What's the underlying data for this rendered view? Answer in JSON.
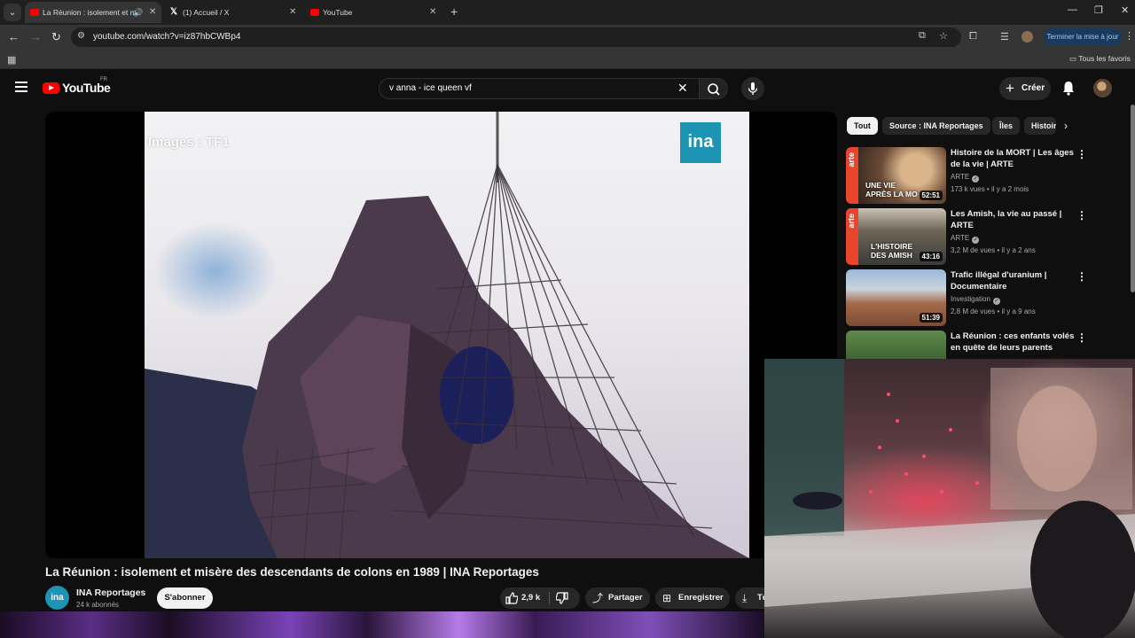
{
  "browser": {
    "tabs": [
      {
        "title": "La Réunion : isolement et m",
        "icon": "youtube-icon",
        "active": true
      },
      {
        "title": "(1) Accueil / X",
        "icon": "x-icon",
        "active": false
      },
      {
        "title": "YouTube",
        "icon": "youtube-icon",
        "active": false
      }
    ],
    "url": "youtube.com/watch?v=iz87hbCWBp4",
    "update_button": "Terminer la mise à jour",
    "bookmarks_all": "Tous les favoris"
  },
  "youtube": {
    "logo": "YouTube",
    "country_code": "FR",
    "search_query": "v anna - ice queen vf",
    "create_label": "Créer",
    "video": {
      "watermark_left": "Images : TF1",
      "watermark_right": "ina",
      "title": "La Réunion : isolement et misère des descendants de colons en 1989 | INA Reportages",
      "channel": {
        "avatar_text": "ina",
        "name": "INA Reportages",
        "subscribers": "24 k abonnés"
      },
      "subscribe_label": "S'abonner",
      "likes": "2,9 k",
      "share_label": "Partager",
      "save_label": "Enregistrer",
      "download_label": "Té"
    },
    "chips": [
      "Tout",
      "Source : INA Reportages",
      "Îles",
      "Histoire"
    ],
    "recommendations": [
      {
        "title": "Histoire de la MORT | Les âges de la vie | ARTE",
        "channel": "ARTE",
        "verified": true,
        "meta": "173 k vues • il y a 2 mois",
        "duration": "52:51",
        "thumb_text": "UNE VIE\nAPRÈS LA MO",
        "thumb_brand": "arte"
      },
      {
        "title": "Les Amish, la vie au passé | ARTE",
        "channel": "ARTE",
        "verified": true,
        "meta": "3,2 M de vues • il y a 2 ans",
        "duration": "43:16",
        "thumb_text": "L'HISTOIRE\nDES AMISH",
        "thumb_brand": "arte"
      },
      {
        "title": "Trafic illégal d'uranium | Documentaire",
        "channel": "Investigation",
        "verified": true,
        "meta": "2,8 M de vues • il y a 9 ans",
        "duration": "51:39"
      },
      {
        "title": "La Réunion : ces enfants volés en quête de leurs parents",
        "channel": "",
        "verified": false,
        "meta": "",
        "duration": ""
      }
    ]
  },
  "colors": {
    "youtube_red": "#ff0000",
    "ina_blue": "#1d94b4",
    "arte_orange": "#e8452c",
    "background": "#0f0f0f"
  }
}
